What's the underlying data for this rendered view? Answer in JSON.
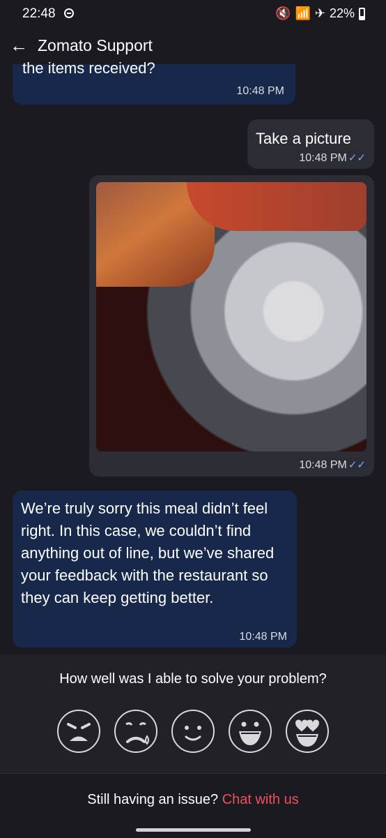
{
  "status": {
    "time": "22:48",
    "battery": "22%"
  },
  "header": {
    "title": "Zomato Support"
  },
  "messages": [
    {
      "direction": "in",
      "text": "the items received?",
      "time": "10:48 PM"
    },
    {
      "direction": "out",
      "text": "Take a picture",
      "time": "10:48 PM"
    },
    {
      "direction": "out",
      "type": "image",
      "time": "10:48 PM"
    },
    {
      "direction": "in",
      "text": "We’re truly sorry this meal didn’t feel right. In this case, we couldn’t find anything out of line, but we’ve shared your feedback with the restaurant so they can keep getting better.",
      "time": "10:48 PM"
    }
  ],
  "rating": {
    "question": "How well was I able to solve your problem?",
    "faces": [
      "angry-face-icon",
      "sad-face-icon",
      "neutral-face-icon",
      "happy-face-icon",
      "heart-eyes-face-icon"
    ]
  },
  "footer": {
    "prompt": "Still having an issue? ",
    "link": "Chat with us"
  }
}
